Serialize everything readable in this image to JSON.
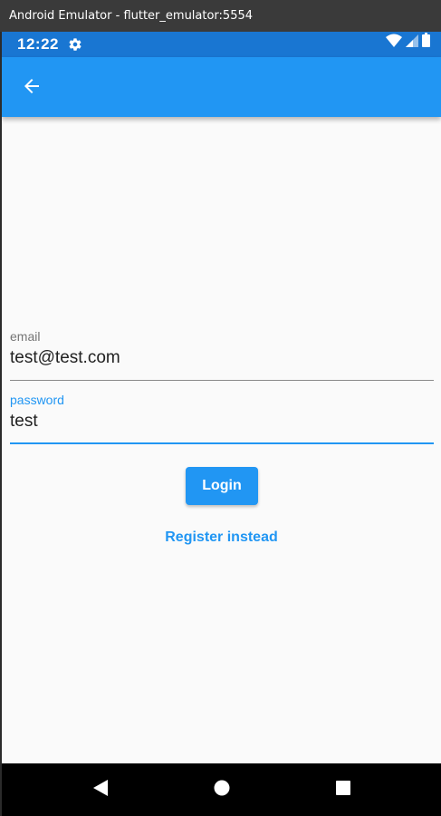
{
  "window": {
    "title": "Android Emulator - flutter_emulator:5554"
  },
  "status_bar": {
    "time": "12:22",
    "icons": [
      "gear-icon",
      "wifi-icon",
      "signal-icon",
      "battery-icon"
    ]
  },
  "app_bar": {
    "back_icon": "arrow-back-icon"
  },
  "form": {
    "email": {
      "label": "email",
      "value": "test@test.com"
    },
    "password": {
      "label": "password",
      "value": "test",
      "focused": true
    },
    "login_label": "Login",
    "register_label": "Register instead"
  },
  "nav_bar": {
    "icons": [
      "back-triangle-icon",
      "home-circle-icon",
      "recents-square-icon"
    ]
  },
  "colors": {
    "primary": "#2196f3",
    "status_bar": "#1976d2",
    "background": "#fafafa"
  }
}
